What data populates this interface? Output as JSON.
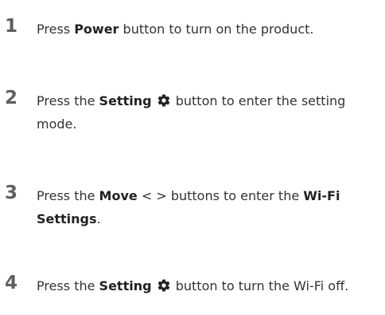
{
  "steps": [
    {
      "number": "1",
      "pre": "Press ",
      "bold1": "Power",
      "post": " button to turn on the product."
    },
    {
      "number": "2",
      "pre": "Press the ",
      "bold1": "Setting",
      "icon": "gear-icon",
      "post": " button to enter the setting mode."
    },
    {
      "number": "3",
      "pre": "Press the ",
      "bold1": "Move",
      "mid": " < > buttons to enter the ",
      "bold2": "Wi-Fi Settings",
      "post": "."
    },
    {
      "number": "4",
      "pre": "Press the ",
      "bold1": "Setting",
      "icon": "gear-icon",
      "post": " button to turn the Wi-Fi off."
    }
  ]
}
